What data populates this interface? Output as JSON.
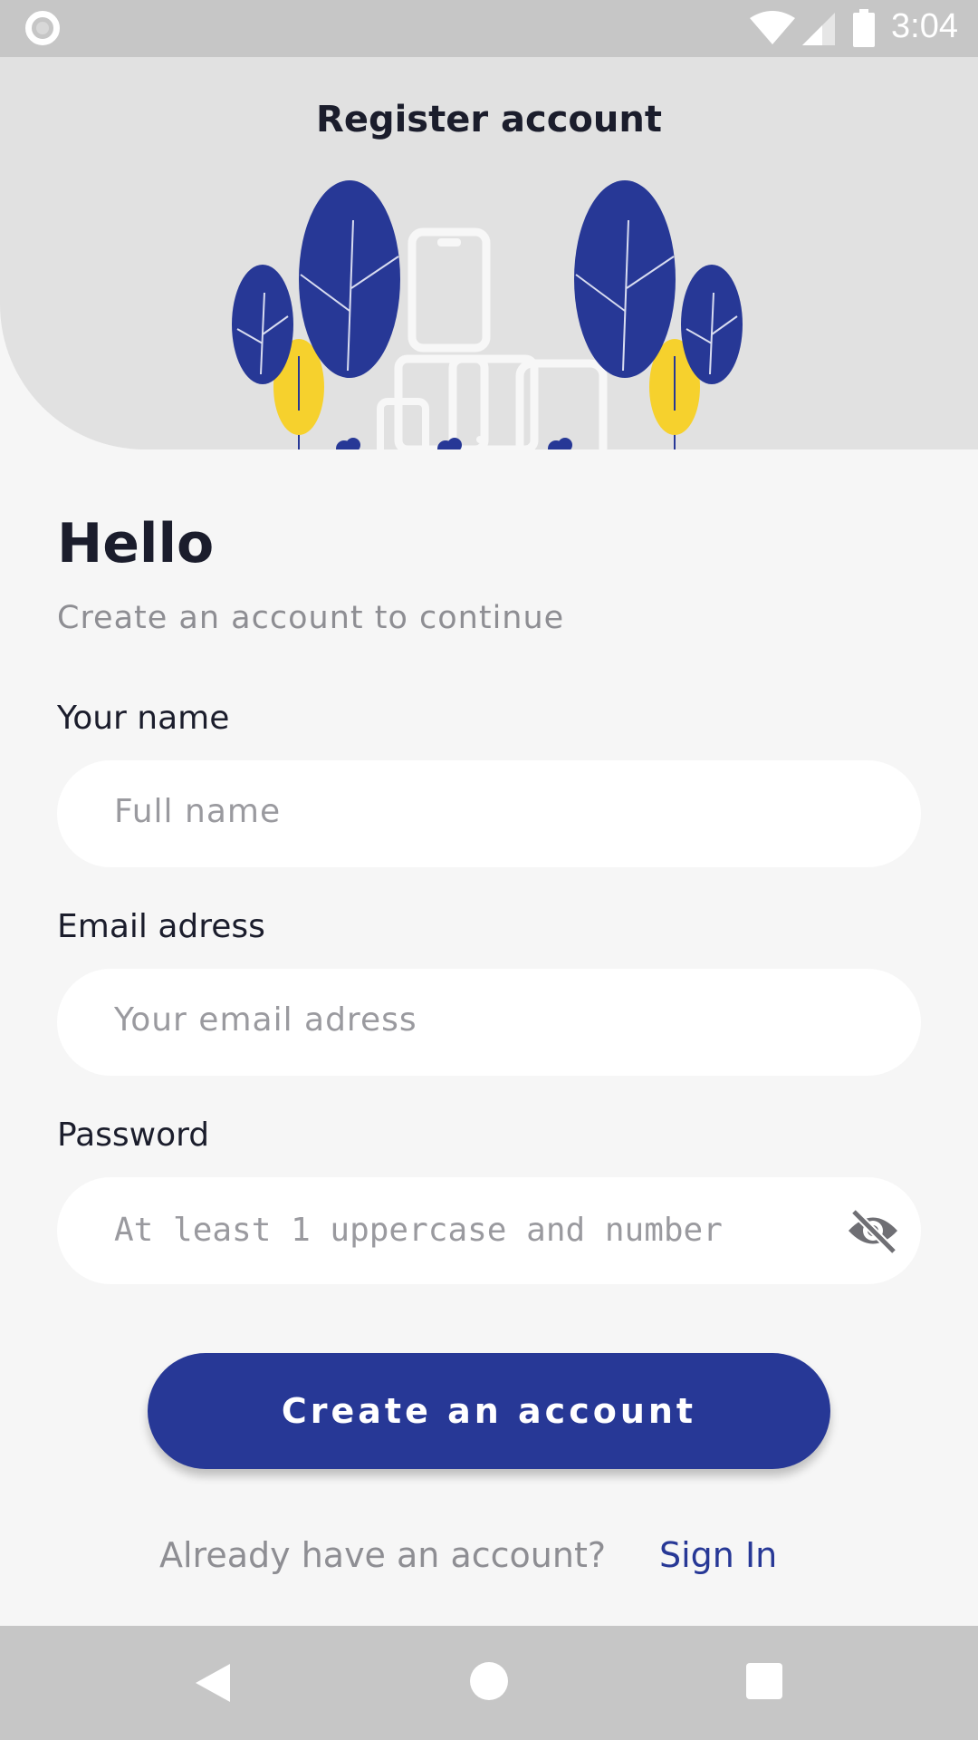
{
  "status_bar": {
    "time": "3:04",
    "icons": [
      "record-icon",
      "wifi-icon",
      "signal-icon",
      "battery-icon"
    ]
  },
  "header": {
    "title": "Register account",
    "illustration": "devices-and-trees-illustration"
  },
  "form": {
    "greeting": "Hello",
    "subtitle": "Create an account to continue",
    "name": {
      "label": "Your name",
      "placeholder": "Full name"
    },
    "email": {
      "label": "Email adress",
      "placeholder": "Your email adress"
    },
    "password": {
      "label": "Password",
      "placeholder": "At least 1 uppercase and number",
      "toggle_icon": "eye-off-icon"
    },
    "submit_label": "Create an account",
    "signin_prompt": "Already have an account?",
    "signin_link": "Sign In"
  },
  "nav_bar": {
    "icons": [
      "back-icon",
      "home-icon",
      "recents-icon"
    ]
  },
  "colors": {
    "primary": "#273896",
    "accent_yellow": "#f6d12d",
    "header_bg": "#e1e1e1",
    "page_bg": "#f6f6f6",
    "text_dark": "#1b1d2c",
    "text_muted": "#8e8e93"
  }
}
